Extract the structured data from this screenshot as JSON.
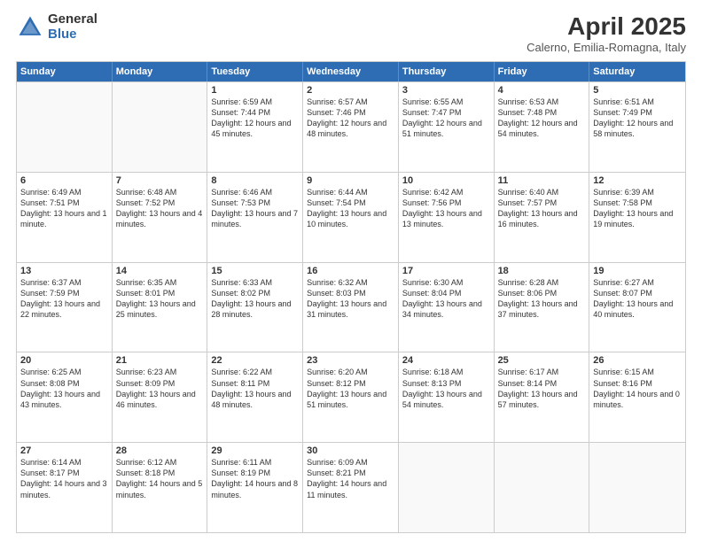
{
  "logo": {
    "general": "General",
    "blue": "Blue"
  },
  "header": {
    "title": "April 2025",
    "subtitle": "Calerno, Emilia-Romagna, Italy"
  },
  "weekdays": [
    "Sunday",
    "Monday",
    "Tuesday",
    "Wednesday",
    "Thursday",
    "Friday",
    "Saturday"
  ],
  "weeks": [
    [
      {
        "day": "",
        "info": ""
      },
      {
        "day": "",
        "info": ""
      },
      {
        "day": "1",
        "info": "Sunrise: 6:59 AM\nSunset: 7:44 PM\nDaylight: 12 hours and 45 minutes."
      },
      {
        "day": "2",
        "info": "Sunrise: 6:57 AM\nSunset: 7:46 PM\nDaylight: 12 hours and 48 minutes."
      },
      {
        "day": "3",
        "info": "Sunrise: 6:55 AM\nSunset: 7:47 PM\nDaylight: 12 hours and 51 minutes."
      },
      {
        "day": "4",
        "info": "Sunrise: 6:53 AM\nSunset: 7:48 PM\nDaylight: 12 hours and 54 minutes."
      },
      {
        "day": "5",
        "info": "Sunrise: 6:51 AM\nSunset: 7:49 PM\nDaylight: 12 hours and 58 minutes."
      }
    ],
    [
      {
        "day": "6",
        "info": "Sunrise: 6:49 AM\nSunset: 7:51 PM\nDaylight: 13 hours and 1 minute."
      },
      {
        "day": "7",
        "info": "Sunrise: 6:48 AM\nSunset: 7:52 PM\nDaylight: 13 hours and 4 minutes."
      },
      {
        "day": "8",
        "info": "Sunrise: 6:46 AM\nSunset: 7:53 PM\nDaylight: 13 hours and 7 minutes."
      },
      {
        "day": "9",
        "info": "Sunrise: 6:44 AM\nSunset: 7:54 PM\nDaylight: 13 hours and 10 minutes."
      },
      {
        "day": "10",
        "info": "Sunrise: 6:42 AM\nSunset: 7:56 PM\nDaylight: 13 hours and 13 minutes."
      },
      {
        "day": "11",
        "info": "Sunrise: 6:40 AM\nSunset: 7:57 PM\nDaylight: 13 hours and 16 minutes."
      },
      {
        "day": "12",
        "info": "Sunrise: 6:39 AM\nSunset: 7:58 PM\nDaylight: 13 hours and 19 minutes."
      }
    ],
    [
      {
        "day": "13",
        "info": "Sunrise: 6:37 AM\nSunset: 7:59 PM\nDaylight: 13 hours and 22 minutes."
      },
      {
        "day": "14",
        "info": "Sunrise: 6:35 AM\nSunset: 8:01 PM\nDaylight: 13 hours and 25 minutes."
      },
      {
        "day": "15",
        "info": "Sunrise: 6:33 AM\nSunset: 8:02 PM\nDaylight: 13 hours and 28 minutes."
      },
      {
        "day": "16",
        "info": "Sunrise: 6:32 AM\nSunset: 8:03 PM\nDaylight: 13 hours and 31 minutes."
      },
      {
        "day": "17",
        "info": "Sunrise: 6:30 AM\nSunset: 8:04 PM\nDaylight: 13 hours and 34 minutes."
      },
      {
        "day": "18",
        "info": "Sunrise: 6:28 AM\nSunset: 8:06 PM\nDaylight: 13 hours and 37 minutes."
      },
      {
        "day": "19",
        "info": "Sunrise: 6:27 AM\nSunset: 8:07 PM\nDaylight: 13 hours and 40 minutes."
      }
    ],
    [
      {
        "day": "20",
        "info": "Sunrise: 6:25 AM\nSunset: 8:08 PM\nDaylight: 13 hours and 43 minutes."
      },
      {
        "day": "21",
        "info": "Sunrise: 6:23 AM\nSunset: 8:09 PM\nDaylight: 13 hours and 46 minutes."
      },
      {
        "day": "22",
        "info": "Sunrise: 6:22 AM\nSunset: 8:11 PM\nDaylight: 13 hours and 48 minutes."
      },
      {
        "day": "23",
        "info": "Sunrise: 6:20 AM\nSunset: 8:12 PM\nDaylight: 13 hours and 51 minutes."
      },
      {
        "day": "24",
        "info": "Sunrise: 6:18 AM\nSunset: 8:13 PM\nDaylight: 13 hours and 54 minutes."
      },
      {
        "day": "25",
        "info": "Sunrise: 6:17 AM\nSunset: 8:14 PM\nDaylight: 13 hours and 57 minutes."
      },
      {
        "day": "26",
        "info": "Sunrise: 6:15 AM\nSunset: 8:16 PM\nDaylight: 14 hours and 0 minutes."
      }
    ],
    [
      {
        "day": "27",
        "info": "Sunrise: 6:14 AM\nSunset: 8:17 PM\nDaylight: 14 hours and 3 minutes."
      },
      {
        "day": "28",
        "info": "Sunrise: 6:12 AM\nSunset: 8:18 PM\nDaylight: 14 hours and 5 minutes."
      },
      {
        "day": "29",
        "info": "Sunrise: 6:11 AM\nSunset: 8:19 PM\nDaylight: 14 hours and 8 minutes."
      },
      {
        "day": "30",
        "info": "Sunrise: 6:09 AM\nSunset: 8:21 PM\nDaylight: 14 hours and 11 minutes."
      },
      {
        "day": "",
        "info": ""
      },
      {
        "day": "",
        "info": ""
      },
      {
        "day": "",
        "info": ""
      }
    ]
  ]
}
